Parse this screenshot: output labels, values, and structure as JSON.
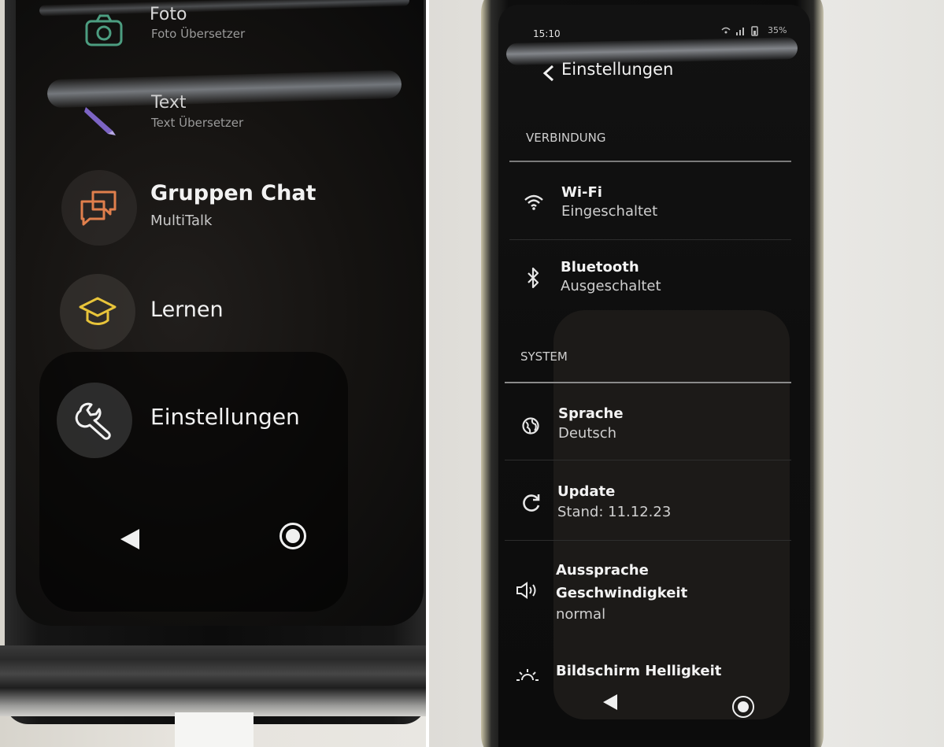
{
  "left_screen": {
    "menu": [
      {
        "title": "Foto",
        "subtitle": "Foto Übersetzer",
        "icon": "camera-icon",
        "color": "#4c9d80"
      },
      {
        "title": "Text",
        "subtitle": "Text Übersetzer",
        "icon": "pen-icon",
        "color": "#8a6ccf"
      },
      {
        "title": "Gruppen Chat",
        "subtitle": "MultiTalk",
        "icon": "chat-bubbles-icon",
        "color": "#e07f4c"
      },
      {
        "title": "Lernen",
        "subtitle": "",
        "icon": "graduation-cap-icon",
        "color": "#e8c43a"
      },
      {
        "title": "Einstellungen",
        "subtitle": "",
        "icon": "wrench-icon",
        "color": "#f2f2f2"
      }
    ],
    "nav": {
      "back_icon": "back-triangle-icon",
      "home_icon": "home-circle-icon"
    }
  },
  "right_screen": {
    "status_bar": {
      "time": "15:10",
      "battery": "35%"
    },
    "header": {
      "title": "Einstellungen",
      "back_icon": "chevron-left-icon"
    },
    "sections": [
      {
        "label": "VERBINDUNG",
        "items": [
          {
            "title": "Wi-Fi",
            "value": "Eingeschaltet",
            "icon": "wifi-icon"
          },
          {
            "title": "Bluetooth",
            "value": "Ausgeschaltet",
            "icon": "bluetooth-icon"
          }
        ]
      },
      {
        "label": "SYSTEM",
        "items": [
          {
            "title": "Sprache",
            "value": "Deutsch",
            "icon": "globe-icon"
          },
          {
            "title": "Update",
            "value": "Stand: 11.12.23",
            "icon": "refresh-icon"
          },
          {
            "title": "Aussprache",
            "title2": "Geschwindigkeit",
            "value": "normal",
            "icon": "speaker-icon"
          },
          {
            "title": "Bildschirm Helligkeit",
            "value": "",
            "icon": "brightness-icon"
          }
        ]
      }
    ],
    "nav": {
      "back_icon": "back-triangle-icon",
      "home_icon": "home-circle-icon"
    }
  }
}
